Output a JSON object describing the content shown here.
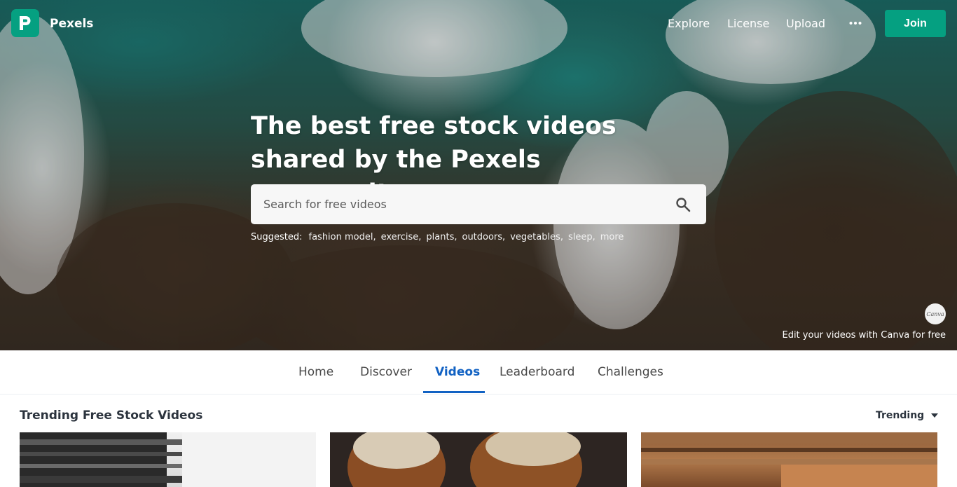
{
  "brand": {
    "name": "Pexels",
    "accent": "#05a081",
    "logo_letter": "P"
  },
  "nav": {
    "links": [
      "Explore",
      "License",
      "Upload"
    ],
    "more_icon": "ellipsis-icon",
    "join_label": "Join"
  },
  "hero": {
    "headline": "The best free stock videos shared by the Pexels community.",
    "search": {
      "placeholder": "Search for free videos",
      "icon": "search-icon"
    },
    "suggested_label": "Suggested:",
    "suggested": [
      "fashion model,",
      "exercise,",
      "plants,",
      "outdoors,",
      "vegetables,",
      "sleep,",
      "more"
    ],
    "canva_badge": "Canva",
    "canva_text": "Edit your videos with Canva for free"
  },
  "tabs": {
    "items": [
      "Home",
      "Discover",
      "Videos",
      "Leaderboard",
      "Challenges"
    ],
    "active": "Videos",
    "active_color": "#1262c3"
  },
  "section": {
    "title": "Trending Free Stock Videos",
    "sort_label": "Trending"
  }
}
